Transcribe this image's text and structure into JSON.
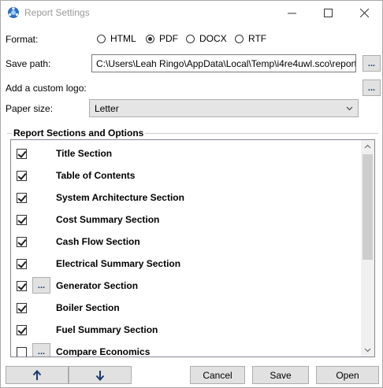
{
  "window": {
    "title": "Report Settings",
    "controls": {
      "minimize": "—",
      "maximize": "☐",
      "close": "✕"
    }
  },
  "format": {
    "label": "Format:",
    "options": [
      {
        "label": "HTML",
        "selected": false
      },
      {
        "label": "PDF",
        "selected": true
      },
      {
        "label": "DOCX",
        "selected": false
      },
      {
        "label": "RTF",
        "selected": false
      }
    ]
  },
  "save_path": {
    "label": "Save path:",
    "value": "C:\\Users\\Leah Ringo\\AppData\\Local\\Temp\\i4re4uwl.sco\\report",
    "browse_label": "..."
  },
  "custom_logo": {
    "label": "Add a custom logo:",
    "browse_label": "..."
  },
  "paper_size": {
    "label": "Paper size:",
    "selected": "Letter"
  },
  "sections": {
    "group_title": "Report Sections and Options",
    "options_label": "...",
    "items": [
      {
        "label": "Title Section",
        "checked": true,
        "has_options": false
      },
      {
        "label": "Table of Contents",
        "checked": true,
        "has_options": false
      },
      {
        "label": "System Architecture Section",
        "checked": true,
        "has_options": false
      },
      {
        "label": "Cost Summary Section",
        "checked": true,
        "has_options": false
      },
      {
        "label": "Cash Flow Section",
        "checked": true,
        "has_options": false
      },
      {
        "label": "Electrical Summary Section",
        "checked": true,
        "has_options": false
      },
      {
        "label": "Generator Section",
        "checked": true,
        "has_options": true
      },
      {
        "label": "Boiler Section",
        "checked": true,
        "has_options": false
      },
      {
        "label": "Fuel Summary Section",
        "checked": true,
        "has_options": false
      },
      {
        "label": "Compare Economics",
        "checked": false,
        "has_options": true
      }
    ]
  },
  "buttons": {
    "move_up": "↑",
    "move_down": "↓",
    "cancel": "Cancel",
    "save": "Save",
    "open": "Open"
  },
  "colors": {
    "accent": "#1e6fc8",
    "button_bg": "#e1e1e1",
    "border": "#adadad"
  }
}
